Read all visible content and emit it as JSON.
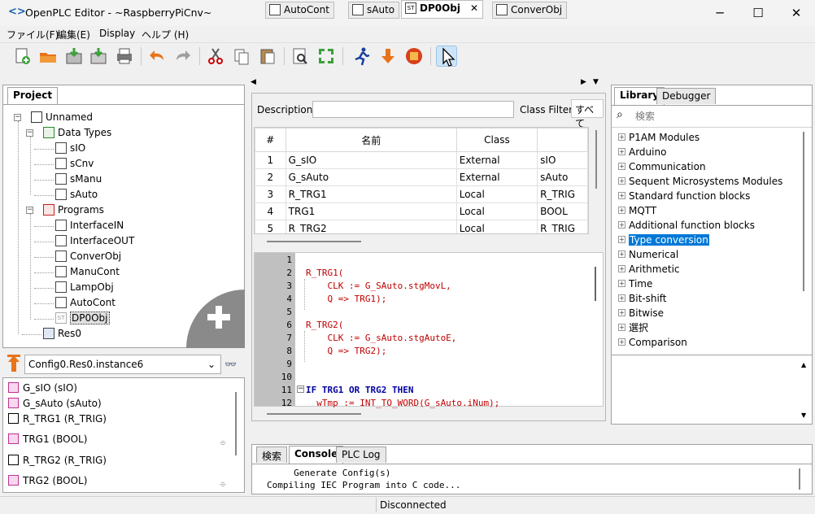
{
  "window": {
    "title": "OpenPLC Editor - ~RaspberryPiCnv~",
    "minimize": "─",
    "maximize": "☐",
    "close": "✕"
  },
  "menu": [
    "ファイル(F)",
    "編集(E)",
    "Display",
    "ヘルプ (H)"
  ],
  "project_panel": {
    "tab": "Project",
    "tree": {
      "root": "Unnamed",
      "data_types": "Data Types",
      "types": [
        "sIO",
        "sCnv",
        "sManu",
        "sAuto"
      ],
      "programs": "Programs",
      "program_items": [
        "InterfaceIN",
        "InterfaceOUT",
        "ConverObj",
        "ManuCont",
        "LampObj",
        "AutoCont",
        "DP0Obj"
      ],
      "resource": "Res0"
    }
  },
  "instance": {
    "selected": "Config0.Res0.instance6"
  },
  "variables": [
    "G_sIO (sIO)",
    "G_sAuto (sAuto)",
    "R_TRG1 (R_TRIG)",
    "TRG1 (BOOL)",
    "R_TRG2 (R_TRIG)",
    "TRG2 (BOOL)"
  ],
  "editor_tabs": [
    {
      "label": "AutoCont",
      "icon": "FBD"
    },
    {
      "label": "sAuto",
      "icon": "type"
    },
    {
      "label": "DP0Obj",
      "icon": "ST",
      "active": true
    },
    {
      "label": "ConverObj",
      "icon": "FBD"
    }
  ],
  "variable_editor": {
    "description_label": "Description:",
    "description_value": "",
    "class_filter_label": "Class Filter:",
    "class_filter_value": "すべて",
    "columns": [
      "#",
      "名前",
      "Class",
      ""
    ],
    "rows": [
      [
        "1",
        "G_sIO",
        "External",
        "sIO"
      ],
      [
        "2",
        "G_sAuto",
        "External",
        "sAuto"
      ],
      [
        "3",
        "R_TRG1",
        "Local",
        "R_TRIG"
      ],
      [
        "4",
        "TRG1",
        "Local",
        "BOOL"
      ],
      [
        "5",
        "R_TRG2",
        "Local",
        "R_TRIG"
      ]
    ]
  },
  "code": {
    "lines": [
      "1",
      "2",
      "3",
      "4",
      "5",
      "6",
      "7",
      "8",
      "9",
      "10",
      "11",
      "12"
    ],
    "text": [
      "",
      "R_TRG1(",
      "    CLK := G_SAuto.stgMovL,",
      "    Q => TRG1);",
      "",
      "R_TRG2(",
      "    CLK := G_sAuto.stgAutoE,",
      "    Q => TRG2);",
      "",
      "",
      "IF TRG1 OR TRG2 THEN",
      "  wTmp := INT_TO_WORD(G_sAuto.iNum);"
    ]
  },
  "library": {
    "tabs": [
      "Library",
      "Debugger"
    ],
    "search_placeholder": "検索",
    "items": [
      "P1AM Modules",
      "Arduino",
      "Communication",
      "Sequent Microsystems Modules",
      "Standard function blocks",
      "MQTT",
      "Additional function blocks",
      "Type conversion",
      "Numerical",
      "Arithmetic",
      "Time",
      "Bit-shift",
      "Bitwise",
      "選択",
      "Comparison"
    ],
    "selected_item": "Type conversion"
  },
  "bottom_tabs": [
    "検索",
    "Console",
    "PLC Log"
  ],
  "console": [
    "     Generate Config(s)",
    "Compiling IEC Program into C code..."
  ],
  "status": "Disconnected",
  "colors": {
    "selection": "#0078d7",
    "keyword": "#0000a0",
    "gutter": "#c0c0c0"
  }
}
